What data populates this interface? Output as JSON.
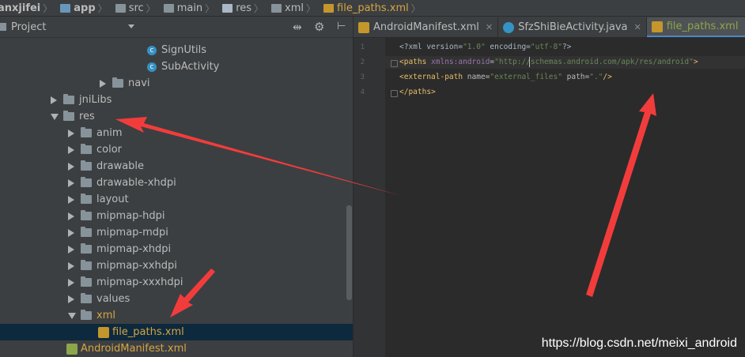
{
  "breadcrumb": [
    {
      "label": "anxjifei",
      "icon": "folder-icon",
      "bold": true
    },
    {
      "label": "app",
      "icon": "module-icon",
      "bold": true
    },
    {
      "label": "src",
      "icon": "folder-icon"
    },
    {
      "label": "main",
      "icon": "folder-icon"
    },
    {
      "label": "res",
      "icon": "res-folder-icon"
    },
    {
      "label": "xml",
      "icon": "folder-icon"
    },
    {
      "label": "file_paths.xml",
      "icon": "xml-file-icon"
    }
  ],
  "project_panel": {
    "title": "Project",
    "icons": [
      "sync-icon",
      "gear-icon",
      "collapse-icon"
    ],
    "tree": [
      {
        "label": "SignUtils",
        "type": "class"
      },
      {
        "label": "SubActivity",
        "type": "class"
      },
      {
        "label": "navi",
        "type": "package",
        "expanded": false
      },
      {
        "label": "jniLibs",
        "type": "folder",
        "expanded": false
      },
      {
        "label": "res",
        "type": "res-folder",
        "expanded": true
      },
      {
        "label": "anim",
        "type": "folder",
        "expanded": false
      },
      {
        "label": "color",
        "type": "folder",
        "expanded": false
      },
      {
        "label": "drawable",
        "type": "folder",
        "expanded": false
      },
      {
        "label": "drawable-xhdpi",
        "type": "folder",
        "expanded": false
      },
      {
        "label": "layout",
        "type": "folder",
        "expanded": false
      },
      {
        "label": "mipmap-hdpi",
        "type": "folder",
        "expanded": false
      },
      {
        "label": "mipmap-mdpi",
        "type": "folder",
        "expanded": false
      },
      {
        "label": "mipmap-xhdpi",
        "type": "folder",
        "expanded": false
      },
      {
        "label": "mipmap-xxhdpi",
        "type": "folder",
        "expanded": false
      },
      {
        "label": "mipmap-xxxhdpi",
        "type": "folder",
        "expanded": false
      },
      {
        "label": "values",
        "type": "folder",
        "expanded": false
      },
      {
        "label": "xml",
        "type": "folder",
        "expanded": true
      },
      {
        "label": "file_paths.xml",
        "type": "xml-file",
        "selected": true
      },
      {
        "label": "AndroidManifest.xml",
        "type": "manifest-file"
      }
    ]
  },
  "editor": {
    "tabs": [
      {
        "label": "AndroidManifest.xml",
        "icon": "manifest-icon",
        "active": false
      },
      {
        "label": "SfzShiBieActivity.java",
        "icon": "class-icon",
        "active": false
      },
      {
        "label": "file_paths.xml",
        "icon": "xml-icon",
        "active": true
      }
    ],
    "lines": [
      {
        "num": "1",
        "parts": [
          [
            "pi",
            "<?xml version="
          ],
          [
            "val",
            "\"1.0\""
          ],
          [
            "pi",
            " encoding="
          ],
          [
            "val",
            "\"utf-8\""
          ],
          [
            "pi",
            "?>"
          ]
        ]
      },
      {
        "num": "2",
        "parts": [
          [
            "tag",
            "<paths "
          ],
          [
            "ns",
            "xmlns:android"
          ],
          [
            "attr",
            "="
          ],
          [
            "val",
            "\"http://schemas.android.com/apk/res/android\""
          ],
          [
            "tag",
            ">"
          ]
        ]
      },
      {
        "num": "3",
        "parts": [
          [
            "tag",
            "<external-path "
          ],
          [
            "attr",
            "name="
          ],
          [
            "val",
            "\"external_files\""
          ],
          [
            "attr",
            " path="
          ],
          [
            "val",
            "\".\""
          ],
          [
            "tag",
            "/>"
          ]
        ]
      },
      {
        "num": "4",
        "parts": [
          [
            "tag",
            "</paths>"
          ]
        ]
      }
    ]
  },
  "watermark": "https://blog.csdn.net/meixi_android",
  "colors": {
    "annotation_arrow": "#f23c3c",
    "selection": "#0d293e",
    "active_tab_underline": "#4a88c7"
  }
}
